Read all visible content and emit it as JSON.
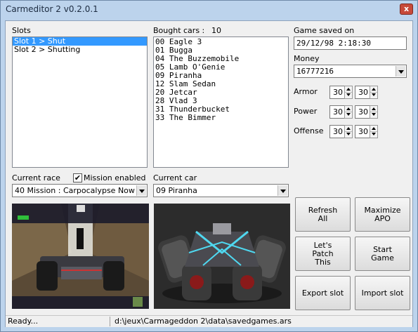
{
  "window": {
    "title": "Carmeditor 2 v0.2.0.1",
    "close_glyph": "x"
  },
  "slots": {
    "label": "Slots",
    "items": [
      "Slot 1 > Shut",
      "Slot 2 > Shutting"
    ],
    "selected_index": 0
  },
  "bought_cars": {
    "label": "Bought cars :",
    "count": "10",
    "items": [
      "00 Eagle 3",
      "01 Bugga",
      "04 The Buzzemobile",
      "05 Lamb O'Genie",
      "09 Piranha",
      "12 Slam Sedan",
      "20 Jetcar",
      "28 Vlad 3",
      "31 Thunderbucket",
      "33 The Bimmer"
    ]
  },
  "game_saved_on": {
    "label": "Game saved on",
    "value": "29/12/98 2:18:30"
  },
  "money": {
    "label": "Money",
    "value": "16777216"
  },
  "stats": {
    "armor": {
      "label": "Armor",
      "value1": "30",
      "value2": "30"
    },
    "power": {
      "label": "Power",
      "value1": "30",
      "value2": "30"
    },
    "offense": {
      "label": "Offense",
      "value1": "30",
      "value2": "30"
    }
  },
  "current_race": {
    "label": "Current race",
    "value": "40 Mission : Carpocalypse Now"
  },
  "mission_enabled": {
    "label": "Mission enabled",
    "checked": true,
    "check_glyph": "✔"
  },
  "current_car": {
    "label": "Current car",
    "value": "09 Piranha"
  },
  "buttons": {
    "refresh": "Refresh\nAll",
    "maximize": "Maximize\nAPO",
    "patch": "Let's\nPatch\nThis",
    "start": "Start\nGame",
    "export": "Export slot",
    "import": "Import slot"
  },
  "status": {
    "left": "Ready...",
    "right": "d:\\jeux\\Carmageddon 2\\data\\savedgames.ars"
  },
  "icons": {
    "app": "app-window-icon",
    "close": "close-icon",
    "combo": "chevron-down-icon",
    "spin_up": "spin-up-icon",
    "spin_down": "spin-down-icon"
  },
  "colors": {
    "titlebar": "#bcd3ec",
    "selection": "#3399ff",
    "close": "#c74a3a"
  }
}
